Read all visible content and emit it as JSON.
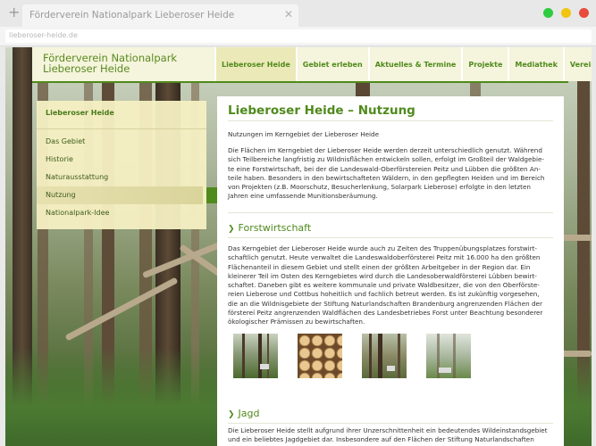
{
  "browser": {
    "tab_title": "Förderverein Nationalpark Lieberoser Heide",
    "new_tab_glyph": "+",
    "close_glyph": "✕",
    "url": "lieberoser-heide.de",
    "window_dots": [
      "#2ecc40",
      "#f1c40f",
      "#e74c3c"
    ]
  },
  "site": {
    "logo_line1": "Förderverein Nationalpark",
    "logo_line2": "Lieberoser Heide",
    "nav": [
      "Lieberoser Heide",
      "Gebiet erleben",
      "Aktuelles & Termine",
      "Projekte",
      "Mediathek",
      "Verein"
    ],
    "active_nav": "Lieberoser Heide",
    "accent_color": "#4f8a1c"
  },
  "sidebar": {
    "title": "Lieberoser Heide",
    "items": [
      "Das Gebiet",
      "Historie",
      "Naturausstattung",
      "Nutzung",
      "Nationalpark-Idee"
    ],
    "active_item": "Nutzung"
  },
  "content": {
    "title": "Lieberoser Heide – Nutzung",
    "subtitle": "Nutzungen im Kerngebiet der Lieberoser Heide",
    "intro_lines": [
      "Die Flächen im Kerngebiet der Lieberoser Heide werden derzeit unterschiedlich genutzt. Während",
      "sich Teilbereiche langfristig zu Wildnisflächen entwickeln sollen, erfolgt im Großteil der Waldgebie-",
      "te eine Forstwirtschaft, bei der die Landeswald-Oberförstereien Peitz und Lübben die größten An-",
      "teile haben. Besonders in den bewirtschafteten Wäldern, in den gepflegten Heiden und im Bereich",
      "von Projekten (z.B. Moorschutz, Besucherlenkung, Solarpark Lieberose) erfolgte in den letzten",
      "Jahren eine umfassende Munitionsberäumung."
    ],
    "section1_title": "Forstwirtschaft",
    "section1_lines": [
      "Das Kerngebiet der Lieberoser Heide wurde auch zu Zeiten des Truppenübungsplatzes forstwirt-",
      "schaftlich genutzt. Heute verwaltet die Landeswaldoberförsterei Peitz mit 16.000 ha den größten",
      "Flächenanteil in diesem Gebiet und stellt einen der größten Arbeitgeber in der Region dar. Ein",
      "kleinerer Teil im Osten des Kerngebietes wird durch die Landesoberwaldförsterei Lübben bewirt-",
      "schaftet. Daneben gibt es weitere kommunale und private Waldbesitzer, die von den Oberförste-",
      "reien Lieberose und Cottbus hoheitlich und fachlich betreut werden. Es ist zukünftig vorgesehen,",
      "die an die Wildnisgebiete der Stiftung Naturlandschaften Brandenburg angrenzenden Flächen der",
      "förstereí Peitz angrenzenden Waldflächen des Landesbetriebes Forst unter Beachtung besonderer",
      "ökologischer Prämissen zu bewirtschaften."
    ],
    "section2_title": "Jagd",
    "section2_lines": [
      "Die Lieberoser Heide stellt aufgrund ihrer Unzerschnittenheit ein bedeutendes Wildeinstandsgebiet",
      "und ein beliebtes Jagdgebiet dar. Insbesondere auf den Flächen der Stiftung Naturlandschaften"
    ],
    "chevron": "❯"
  }
}
